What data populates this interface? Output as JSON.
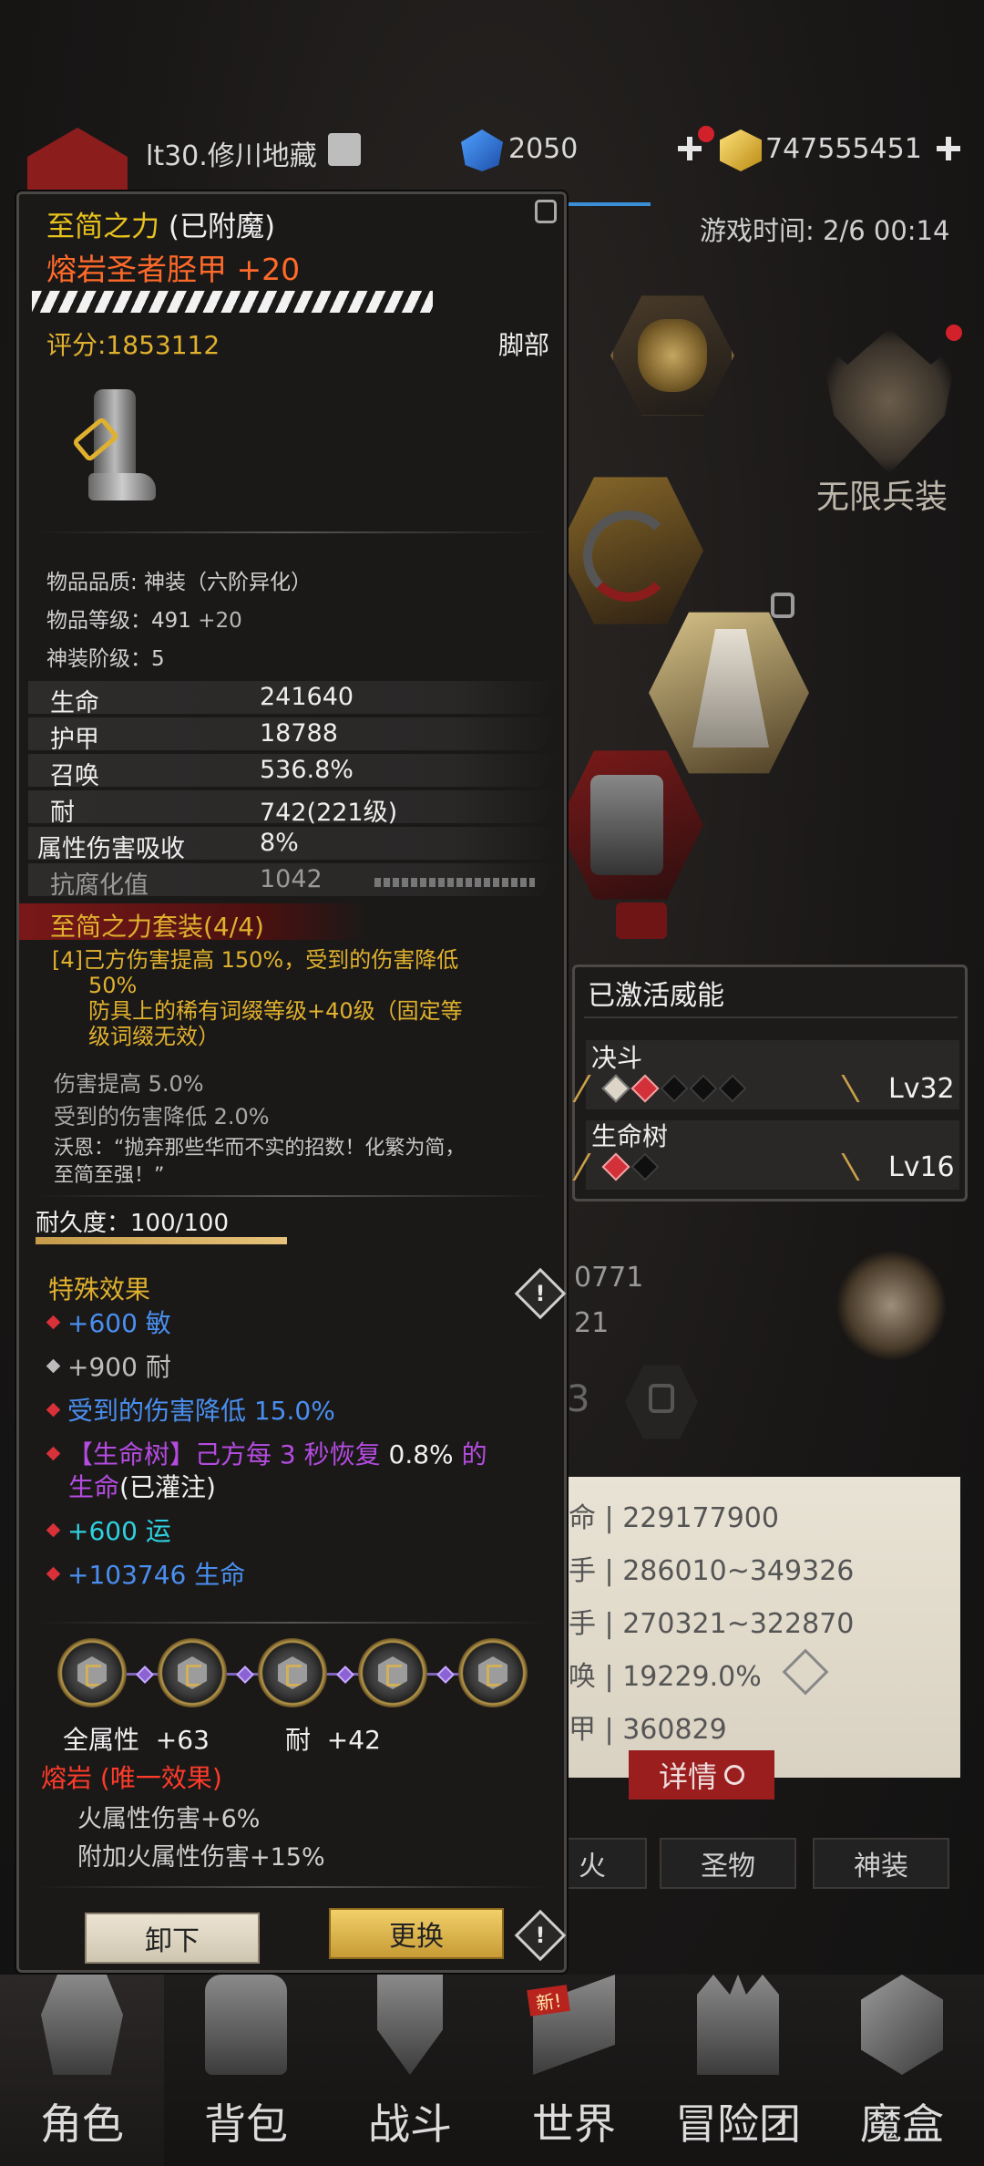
{
  "header": {
    "player": "lt30.修川地藏",
    "gems": "2050",
    "gold": "747555451",
    "game_time": "游戏时间: 2/6 00:14"
  },
  "right_panel": {
    "infinite_gear": "无限兵装",
    "partial_numbers": [
      "0771",
      "21",
      "3"
    ],
    "stats": [
      {
        "name": "命",
        "value": "229177900"
      },
      {
        "name": "手",
        "value": "286010~349326"
      },
      {
        "name": "手",
        "value": "270321~322870"
      },
      {
        "name": "唤",
        "value": "19229.0%"
      },
      {
        "name": "甲",
        "value": "360829"
      }
    ],
    "details_button": "详情",
    "tabs": [
      "火",
      "圣物",
      "神装"
    ]
  },
  "item": {
    "set_name": "至简之力",
    "enchant_tag": "(已附魔)",
    "name": "熔岩圣者胫甲 +20",
    "score": "评分:1853112",
    "slot": "脚部",
    "quality": "物品品质: 神装（六阶异化）",
    "level_label": "物品等级：",
    "level": "491",
    "level_bonus": "+20",
    "divine_tier": "神装阶级：5",
    "stats": [
      {
        "name": "生命",
        "value": "241640"
      },
      {
        "name": "护甲",
        "value": "18788"
      },
      {
        "name": "召唤",
        "value": "536.8%"
      },
      {
        "name": "耐",
        "value": "742(221级)"
      },
      {
        "name": "属性伤害吸收",
        "value": "8%"
      }
    ],
    "corruption_name": "抗腐化值",
    "corruption_value": "1042",
    "set_title": "至简之力套装(4/4)",
    "set_bonus_lines": [
      "[4]己方伤害提高 150%，受到的伤害降低",
      "50%",
      "防具上的稀有词缀等级+40级（固定等",
      "级词缀无效）"
    ],
    "passive_lines": [
      "伤害提高 5.0%",
      "受到的伤害降低 2.0%"
    ],
    "quote_lines": [
      "沃恩：“抛弃那些华而不实的招数！化繁为简，",
      "至简至强！”"
    ],
    "durability": "耐久度：100/100",
    "durability_fraction": 1.0,
    "special_title": "特殊效果",
    "effects": [
      {
        "text": "+600 敏",
        "color": "#4a8ff0",
        "dot": "red"
      },
      {
        "text": "+900 耐",
        "color": "#bdbdbd",
        "dot": "grey"
      },
      {
        "text": "受到的伤害降低 15.0%",
        "color": "#4a8ff0",
        "dot": "red"
      },
      {
        "text": "+600 运",
        "color": "#2fd0e0",
        "dot": "red"
      },
      {
        "text": "+103746 生命",
        "color": "#4a8ff0",
        "dot": "red"
      }
    ],
    "lifetree_effect": {
      "p1": "【生命树】己方每 3 秒恢复 ",
      "p2": "0.8%",
      "p3": " 的",
      "p4": "生命",
      "p5": "(已灌注)"
    },
    "socket_bonus_all": "全属性  +63",
    "socket_bonus_end": "耐  +42",
    "lava_title": "熔岩 (唯一效果)",
    "lava_lines": [
      "火属性伤害+6%",
      "附加火属性伤害+15%"
    ],
    "unequip": "卸下",
    "replace": "更换",
    "warn": "!"
  },
  "abilities": {
    "title": "已激活威能",
    "items": [
      {
        "name": "决斗",
        "level": "Lv32"
      },
      {
        "name": "生命树",
        "level": "Lv16"
      }
    ]
  },
  "nav": [
    "角色",
    "背包",
    "战斗",
    "世界",
    "冒险团",
    "魔盒"
  ],
  "new_badge": "新!",
  "colors": {
    "gold_text": "#e0b12e",
    "item_name": "#ff6a2a",
    "blue_effect": "#4a8ff0",
    "purple_effect": "#b44ce0",
    "cyan_effect": "#2fd0e0",
    "lava_red": "#ff3b2a"
  }
}
